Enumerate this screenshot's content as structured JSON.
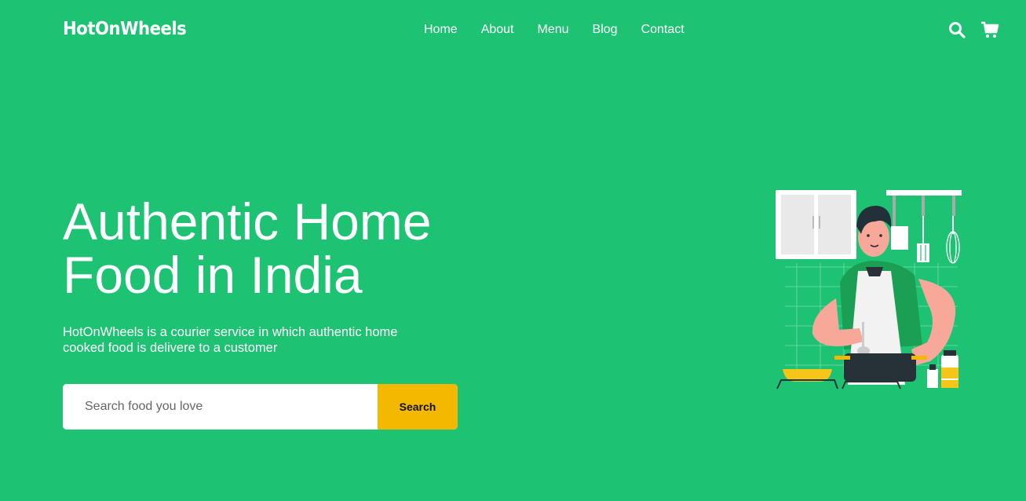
{
  "brand": {
    "name": "HotOnWheels"
  },
  "nav": {
    "items": [
      {
        "label": "Home"
      },
      {
        "label": "About"
      },
      {
        "label": "Menu"
      },
      {
        "label": "Blog"
      },
      {
        "label": "Contact"
      }
    ],
    "icons": [
      "search-icon",
      "cart-icon"
    ]
  },
  "hero": {
    "title_line1": "Authentic Home",
    "title_line2": "Food in India",
    "description": "HotOnWheels is a courier service in which authentic home cooked food is delivere to a customer",
    "search": {
      "placeholder": "Search food you love",
      "value": "",
      "button_label": "Search"
    }
  },
  "colors": {
    "background": "#1dc273",
    "accent": "#f5b800",
    "text": "#ffffff"
  }
}
